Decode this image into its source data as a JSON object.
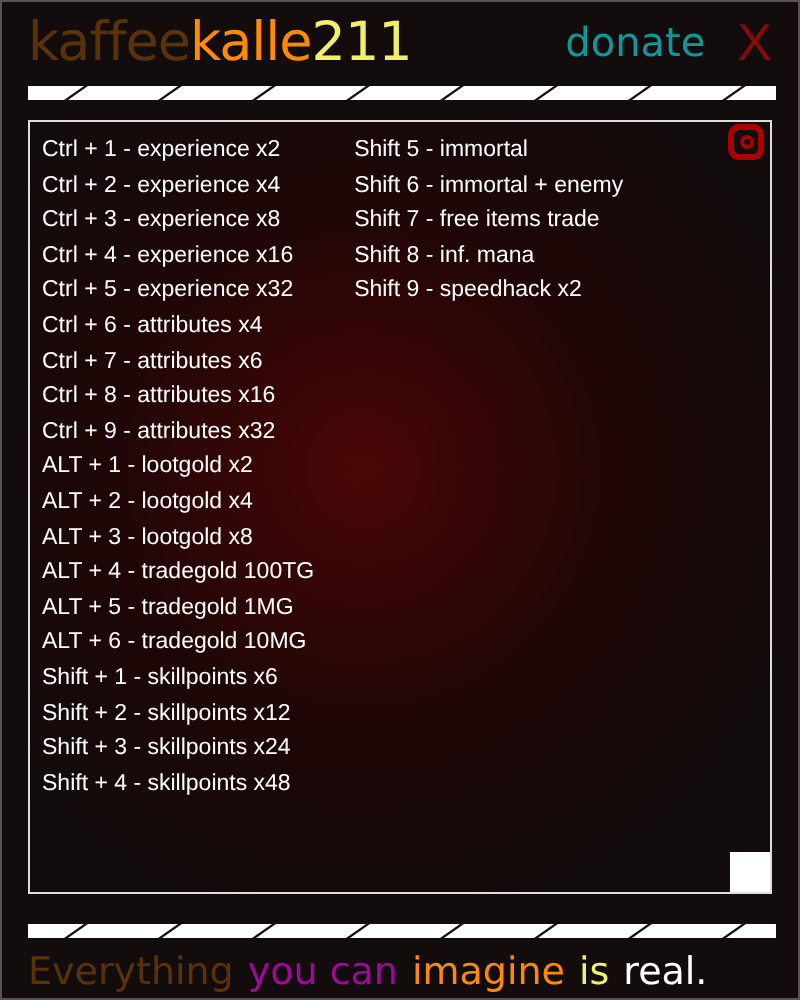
{
  "header": {
    "logo": [
      {
        "text": "kaffee",
        "color": "#5a3208"
      },
      {
        "text": "kalle",
        "color": "#ff8a00"
      },
      {
        "text": "211",
        "color": "#f2f06a"
      }
    ],
    "donate": "donate",
    "close": "X"
  },
  "hotkeys": {
    "columns": [
      [
        "Ctrl + 1 - experience x2",
        "Ctrl + 2 - experience x4",
        "Ctrl + 3 - experience x8",
        "Ctrl + 4 - experience x16",
        "Ctrl + 5 - experience x32",
        "Ctrl + 6 - attributes x4",
        "Ctrl + 7 - attributes x6",
        "Ctrl + 8 - attributes x16",
        "Ctrl + 9 - attributes x32",
        "ALT + 1 - lootgold x2",
        "ALT + 2 - lootgold x4",
        "ALT + 3 - lootgold x8",
        "ALT + 4 - tradegold 100TG",
        "ALT + 5 - tradegold 1MG",
        "ALT + 6 - tradegold 10MG",
        "Shift + 1 - skillpoints x6",
        "Shift + 2 - skillpoints x12",
        "Shift + 3 - skillpoints x24",
        "Shift + 4 - skillpoints x48"
      ],
      [
        "Shift 5 - immortal",
        "Shift 6 - immortal + enemy",
        "Shift 7 - free items trade",
        "Shift 8 - inf. mana",
        "Shift 9 - speedhack x2"
      ]
    ]
  },
  "tagline": [
    {
      "text": "Everything",
      "color": "#5a3208"
    },
    {
      "text": "you can",
      "color": "#a0089a"
    },
    {
      "text": "imagine",
      "color": "#ff8a00"
    },
    {
      "text": "is",
      "color": "#f2f06a"
    },
    {
      "text": "real.",
      "color": "#ffffff"
    }
  ]
}
